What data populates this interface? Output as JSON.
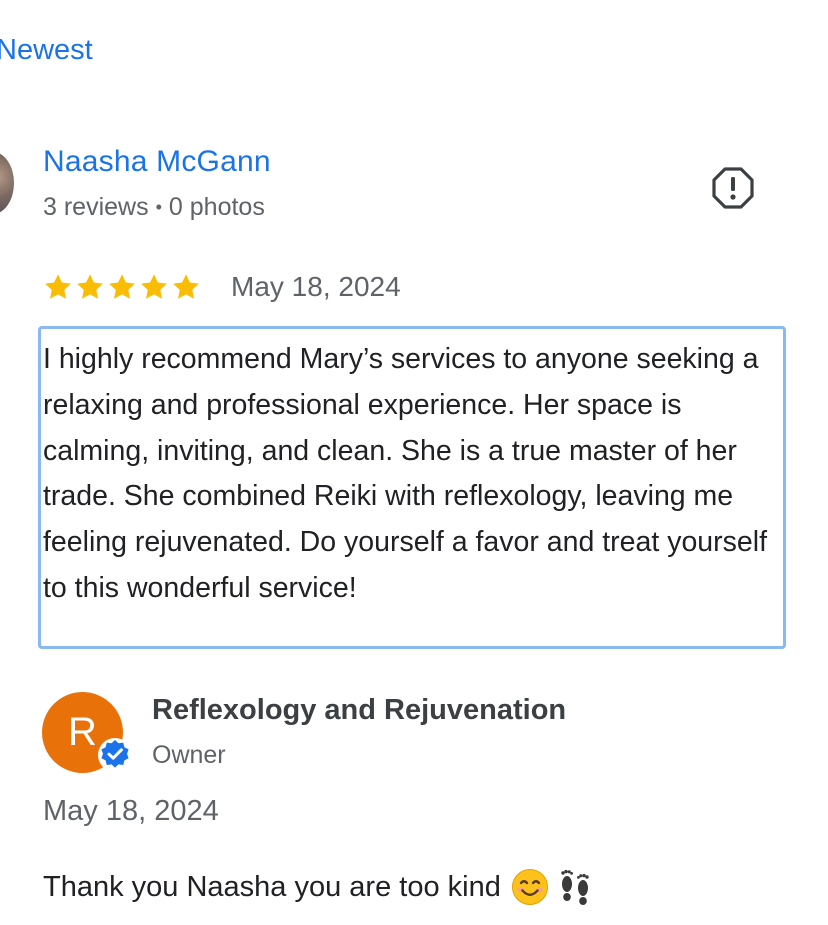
{
  "sort": {
    "label": "Newest"
  },
  "review": {
    "author_name": "Naasha McGann",
    "reviews_count": "3 reviews",
    "separator": "•",
    "photos_count": "0 photos",
    "rating": 5,
    "rating_max": 5,
    "date": "May 18, 2024",
    "text": "I highly recommend Mary’s services to anyone seeking a relaxing and professional experience. Her space is calming, inviting, and clean. She is a true master of her trade. She combined Reiki with reflexology, leaving me feeling rejuvenated. Do yourself a favor and treat yourself to this wonderful service!",
    "flag_icon": "report-flag-icon"
  },
  "owner_reply": {
    "avatar_initial": "R",
    "business_name": "Reflexology and Rejuvenation",
    "role": "Owner",
    "verified_icon": "verified-badge-icon",
    "date": "May 18, 2024",
    "text": "Thank you Naasha you are too kind",
    "emojis": [
      "smiling-face-emoji",
      "footprints-emoji"
    ]
  },
  "colors": {
    "link_blue": "#1a73e8",
    "star_gold": "#fbbc04",
    "highlight_border": "#8ab8f0",
    "owner_avatar": "#e8710a"
  }
}
